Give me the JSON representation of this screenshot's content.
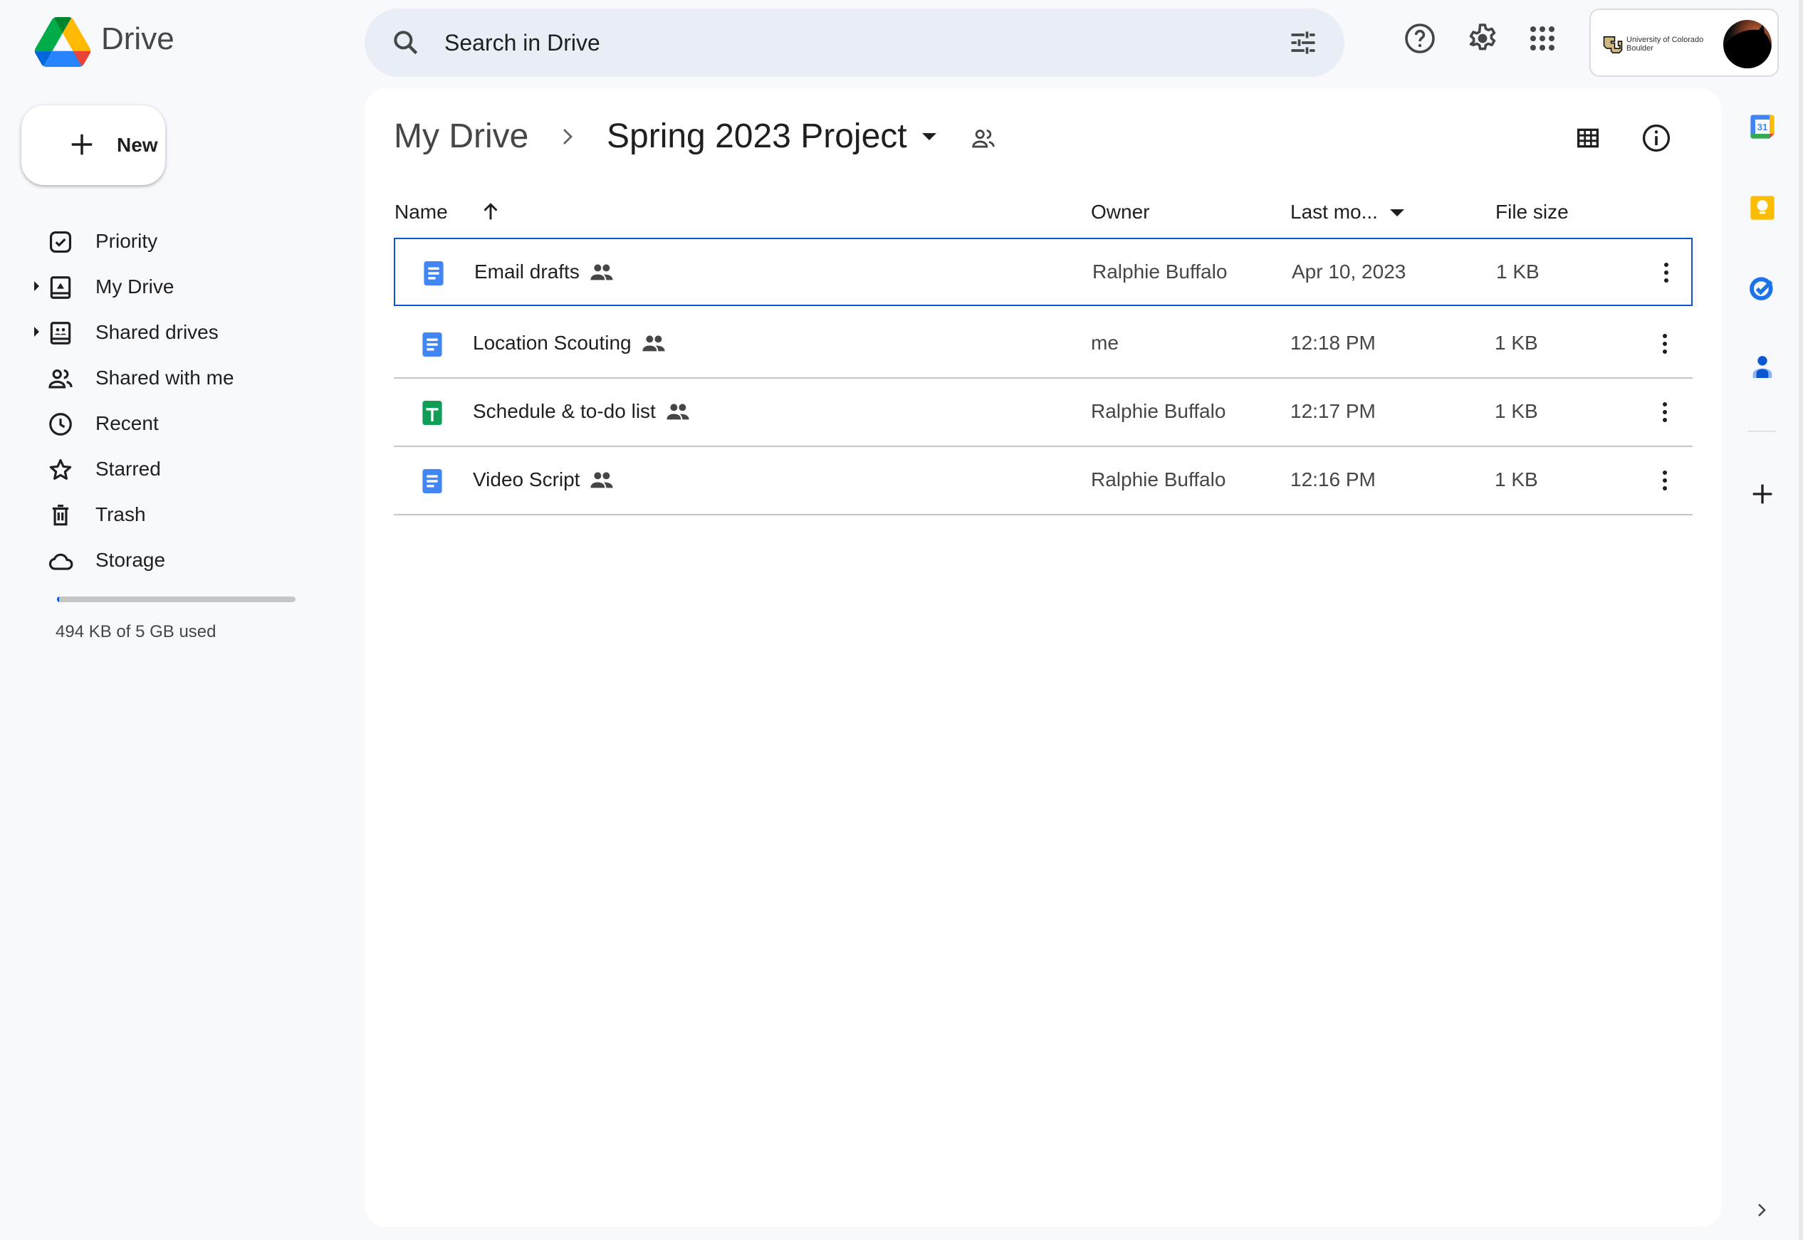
{
  "app": {
    "name": "Drive",
    "brand_colors": {
      "green": "#34a853",
      "yellow": "#fbbc04",
      "blue": "#4285f4",
      "red": "#ea4335",
      "accent": "#0b57d0"
    }
  },
  "new_button": {
    "label": "New",
    "icon": "plus-icon"
  },
  "sidebar": {
    "items": [
      {
        "label": "Priority",
        "icon": "priority-check-icon",
        "expandable": false
      },
      {
        "label": "My Drive",
        "icon": "my-drive-icon",
        "expandable": true
      },
      {
        "label": "Shared drives",
        "icon": "shared-drives-icon",
        "expandable": true
      },
      {
        "label": "Shared with me",
        "icon": "people-icon",
        "expandable": false
      },
      {
        "label": "Recent",
        "icon": "clock-icon",
        "expandable": false
      },
      {
        "label": "Starred",
        "icon": "star-icon",
        "expandable": false
      },
      {
        "label": "Trash",
        "icon": "trash-icon",
        "expandable": false
      },
      {
        "label": "Storage",
        "icon": "cloud-icon",
        "expandable": false
      }
    ],
    "storage": {
      "used_text": "494 KB of 5 GB used",
      "used_fraction": 0.0001
    }
  },
  "search": {
    "placeholder": "Search in Drive",
    "value": ""
  },
  "header": {
    "icons": [
      "help-icon",
      "settings-icon",
      "apps-grid-icon"
    ],
    "account": {
      "org_line1": "University of Colorado",
      "org_line2": "Boulder"
    }
  },
  "breadcrumb": {
    "root": "My Drive",
    "current": "Spring 2023 Project"
  },
  "table": {
    "columns": {
      "name": "Name",
      "owner": "Owner",
      "modified": "Last mo...",
      "size": "File size"
    },
    "rows": [
      {
        "type": "doc",
        "name": "Email drafts",
        "shared": true,
        "owner": "Ralphie Buffalo",
        "modified": "Apr 10, 2023",
        "size": "1 KB",
        "selected": true
      },
      {
        "type": "doc",
        "name": "Location Scouting",
        "shared": true,
        "owner": "me",
        "modified": "12:18 PM",
        "size": "1 KB",
        "selected": false
      },
      {
        "type": "sheet",
        "name": "Schedule & to-do list",
        "shared": true,
        "owner": "Ralphie Buffalo",
        "modified": "12:17 PM",
        "size": "1 KB",
        "selected": false
      },
      {
        "type": "doc",
        "name": "Video Script",
        "shared": true,
        "owner": "Ralphie Buffalo",
        "modified": "12:16 PM",
        "size": "1 KB",
        "selected": false
      }
    ]
  },
  "side_panel": {
    "apps": [
      "calendar-icon",
      "keep-icon",
      "tasks-icon",
      "contacts-icon"
    ],
    "calendar_day": "31"
  }
}
